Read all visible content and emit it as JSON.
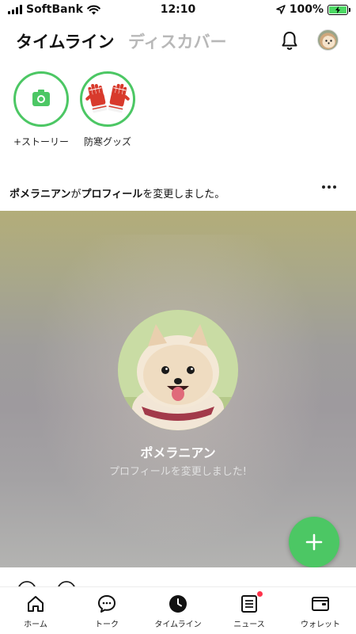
{
  "status_bar": {
    "carrier": "SoftBank",
    "time": "12:10",
    "battery": "100%"
  },
  "header": {
    "tabs": [
      {
        "label": "タイムライン",
        "active": true
      },
      {
        "label": "ディスカバー",
        "active": false
      }
    ],
    "icons": [
      "bell-icon",
      "profile-avatar"
    ]
  },
  "stories": {
    "items": [
      {
        "label": "+ストーリー",
        "icon": "camera-icon"
      },
      {
        "label": "防寒グッズ",
        "icon": "gloves-image"
      }
    ]
  },
  "post": {
    "author": "ポメラニアン",
    "message_part_1": "が",
    "profile_word": "プロフィール",
    "message_part_2": "を変更しました。",
    "card_name": "ポメラニアン",
    "card_subtitle": "プロフィールを変更しました!"
  },
  "fab": {
    "icon": "plus-icon"
  },
  "bottom_nav": {
    "items": [
      {
        "label": "ホーム",
        "icon": "home-icon"
      },
      {
        "label": "トーク",
        "icon": "chat-icon"
      },
      {
        "label": "タイムライン",
        "icon": "clock-icon",
        "active": true
      },
      {
        "label": "ニュース",
        "icon": "news-icon",
        "badge": true
      },
      {
        "label": "ウォレット",
        "icon": "wallet-icon"
      }
    ]
  },
  "colors": {
    "accent": "#4cc764",
    "badge": "#ff334b",
    "inactive_tab": "#b8b8b8"
  }
}
